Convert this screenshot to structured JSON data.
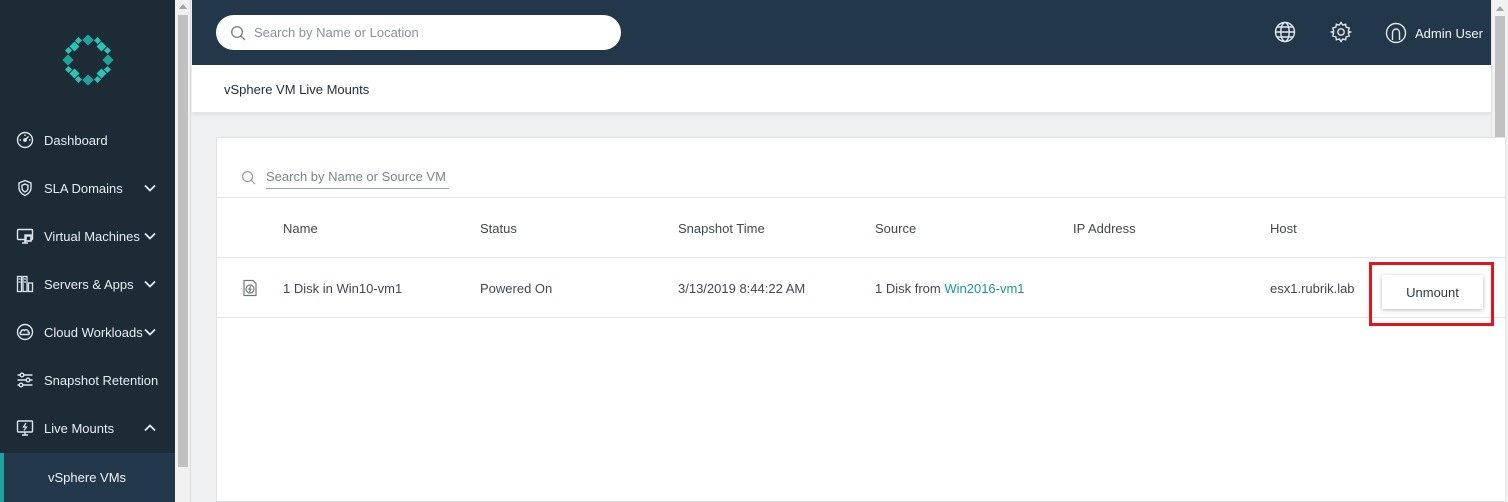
{
  "app": {
    "brand_color": "#1ea39a",
    "highlight_color": "#e0161c"
  },
  "topbar": {
    "search_placeholder": "Search by Name or Location",
    "globe_icon": "globe-icon",
    "settings_icon": "gear-icon",
    "user_name": "Admin User"
  },
  "sidebar": {
    "items": [
      {
        "label": "Dashboard",
        "icon": "gauge-icon",
        "expandable": false
      },
      {
        "label": "SLA Domains",
        "icon": "shield-icon",
        "expandable": true
      },
      {
        "label": "Virtual Machines",
        "icon": "monitor-icon",
        "expandable": true
      },
      {
        "label": "Servers & Apps",
        "icon": "grid-icon",
        "expandable": true
      },
      {
        "label": "Cloud Workloads",
        "icon": "cloud-icon",
        "expandable": true
      },
      {
        "label": "Snapshot Retention",
        "icon": "sliders-icon",
        "expandable": false
      },
      {
        "label": "Live Mounts",
        "icon": "live-mount-icon",
        "expandable": true,
        "expanded": true
      }
    ],
    "sub_item": "vSphere VMs"
  },
  "page": {
    "title": "vSphere VM Live Mounts"
  },
  "table": {
    "search_placeholder": "Search by Name or Source VM",
    "columns": [
      "Name",
      "Status",
      "Snapshot Time",
      "Source",
      "IP Address",
      "Host"
    ],
    "rows": [
      {
        "name": "1 Disk in Win10-vm1",
        "status": "Powered On",
        "snapshot_time": "3/13/2019 8:44:22 AM",
        "source_prefix": "1 Disk from ",
        "source_link": "Win2016-vm1",
        "ip_address": "",
        "host": "esx1.rubrik.lab",
        "action": "Unmount"
      }
    ]
  }
}
